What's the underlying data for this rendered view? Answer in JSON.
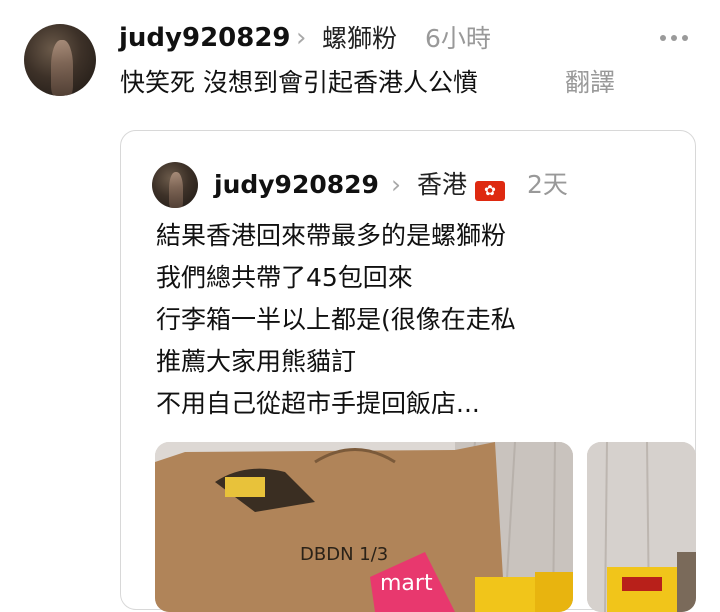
{
  "post": {
    "author": "judy920829",
    "replying_to": "螺獅粉",
    "time": "6小時",
    "text": "快笑死 沒想到會引起香港人公憤",
    "translate_label": "翻譯"
  },
  "quoted_post": {
    "author": "judy920829",
    "location": "香港",
    "flag": "🇭🇰",
    "time": "2天",
    "lines": [
      "結果香港回來帶最多的是螺獅粉",
      "我們總共帶了45包回來",
      "行李箱一半以上都是(很像在走私",
      "推薦大家用熊貓訂",
      "不用自己從超市手提回飯店..."
    ],
    "photo_text": "DBDN 1/3",
    "photo_brand": "mart"
  },
  "icons": {
    "more": "more-dots-icon",
    "chevron": "chevron-right-icon",
    "flag": "hong-kong-flag-icon"
  },
  "colors": {
    "muted": "#999999",
    "border": "#d8d8d8",
    "flag_red": "#de2910",
    "bag_pink": "#e8386e"
  }
}
